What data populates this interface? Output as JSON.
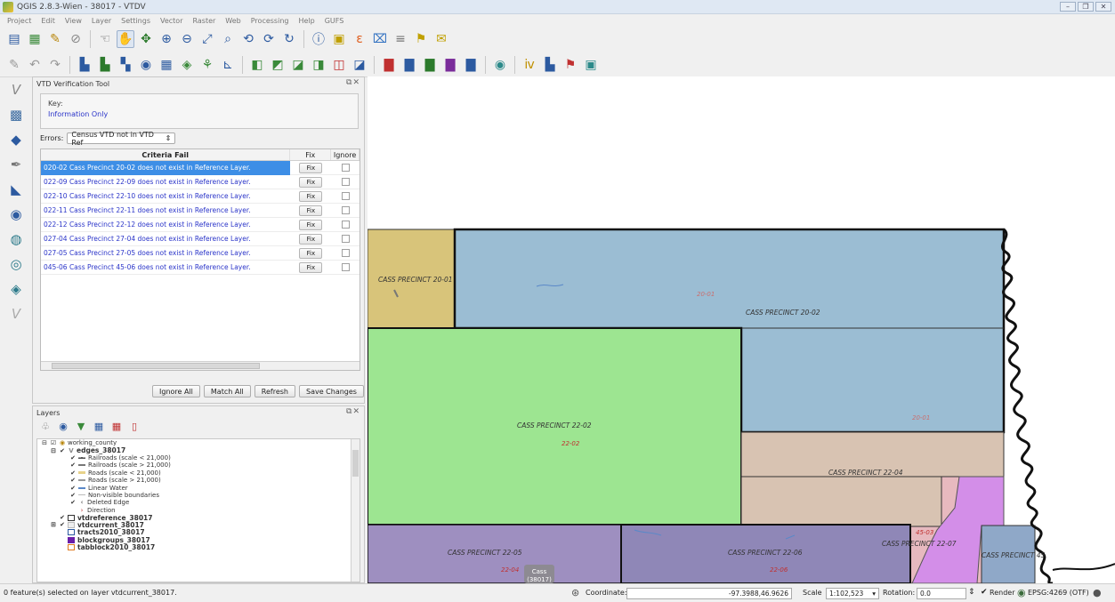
{
  "window": {
    "title": "QGIS 2.8.3-Wien - 38017 - VTDV",
    "controls": [
      "–",
      "❐",
      "✕"
    ]
  },
  "menu": [
    "Project",
    "Edit",
    "View",
    "Layer",
    "Settings",
    "Vector",
    "Raster",
    "Web",
    "Processing",
    "Help",
    "GUFS"
  ],
  "vtd": {
    "title": "VTD Verification Tool",
    "key_label": "Key:",
    "key_value": "Information Only",
    "errors_label": "Errors:",
    "errors_value": "Census VTD not in VTD Ref",
    "col_criteria": "Criteria Fail",
    "col_fix": "Fix",
    "col_ignore": "Ignore",
    "fix_label": "Fix",
    "rows": [
      "020-02 Cass Precinct 20-02 does not exist in Reference Layer.",
      "022-09 Cass Precinct 22-09 does not exist in Reference Layer.",
      "022-10 Cass Precinct 22-10 does not exist in Reference Layer.",
      "022-11 Cass Precinct 22-11 does not exist in Reference Layer.",
      "022-12 Cass Precinct 22-12 does not exist in Reference Layer.",
      "027-04 Cass Precinct 27-04 does not exist in Reference Layer.",
      "027-05 Cass Precinct 27-05 does not exist in Reference Layer.",
      "045-06 Cass Precinct 45-06 does not exist in Reference Layer."
    ],
    "buttons": {
      "ignore_all": "Ignore All",
      "match_all": "Match All",
      "refresh": "Refresh",
      "save": "Save Changes"
    }
  },
  "layers": {
    "title": "Layers",
    "items": [
      {
        "label": "working_county",
        "bold": false
      },
      {
        "label": "edges_38017",
        "bold": true
      },
      {
        "label": "Railroads (scale < 21,000)",
        "bold": false
      },
      {
        "label": "Railroads (scale > 21,000)",
        "bold": false
      },
      {
        "label": "Roads (scale < 21,000)",
        "bold": false
      },
      {
        "label": "Roads (scale > 21,000)",
        "bold": false
      },
      {
        "label": "Linear Water",
        "bold": false
      },
      {
        "label": "Non-visible boundaries",
        "bold": false
      },
      {
        "label": "Deleted Edge",
        "bold": false
      },
      {
        "label": "Direction",
        "bold": false
      },
      {
        "label": "vtdreference_38017",
        "bold": true
      },
      {
        "label": "vtdcurrent_38017",
        "bold": true
      },
      {
        "label": "tracts2010_38017",
        "bold": true
      },
      {
        "label": "blockgroups_38017",
        "bold": true
      },
      {
        "label": "tabblock2010_38017",
        "bold": true
      }
    ]
  },
  "map": {
    "labels": {
      "p2001": "CASS PRECINCT 20-01",
      "p2002": "CASS PRECINCT 20-02",
      "c2001": "20-01",
      "c2002": "20-01",
      "p2202": "CASS PRECINCT 22-02",
      "c2202": "22-02",
      "p2204": "CASS PRECINCT 22-04",
      "c2205": "22-04",
      "p2205": "CASS PRECINCT 22-05",
      "p2206": "CASS PRECINCT 22-06",
      "c2206": "22-06",
      "p2207": "CASS PRECINCT 22-07",
      "c4503": "45-03",
      "p45": "CASS PRECINCT 45",
      "cass": "Cass",
      "cass_code": "(38017)",
      "c_right": "20-01"
    }
  },
  "status": {
    "selected": "0 feature(s) selected on layer vtdcurrent_38017.",
    "coordinate_label": "Coordinate:",
    "coordinate_value": "-97.3988,46.9626",
    "scale_label": "Scale",
    "scale_value": "1:102,523",
    "rotation_label": "Rotation:",
    "rotation_value": "0.0",
    "render_label": "Render",
    "crs": "EPSG:4269 (OTF)"
  }
}
